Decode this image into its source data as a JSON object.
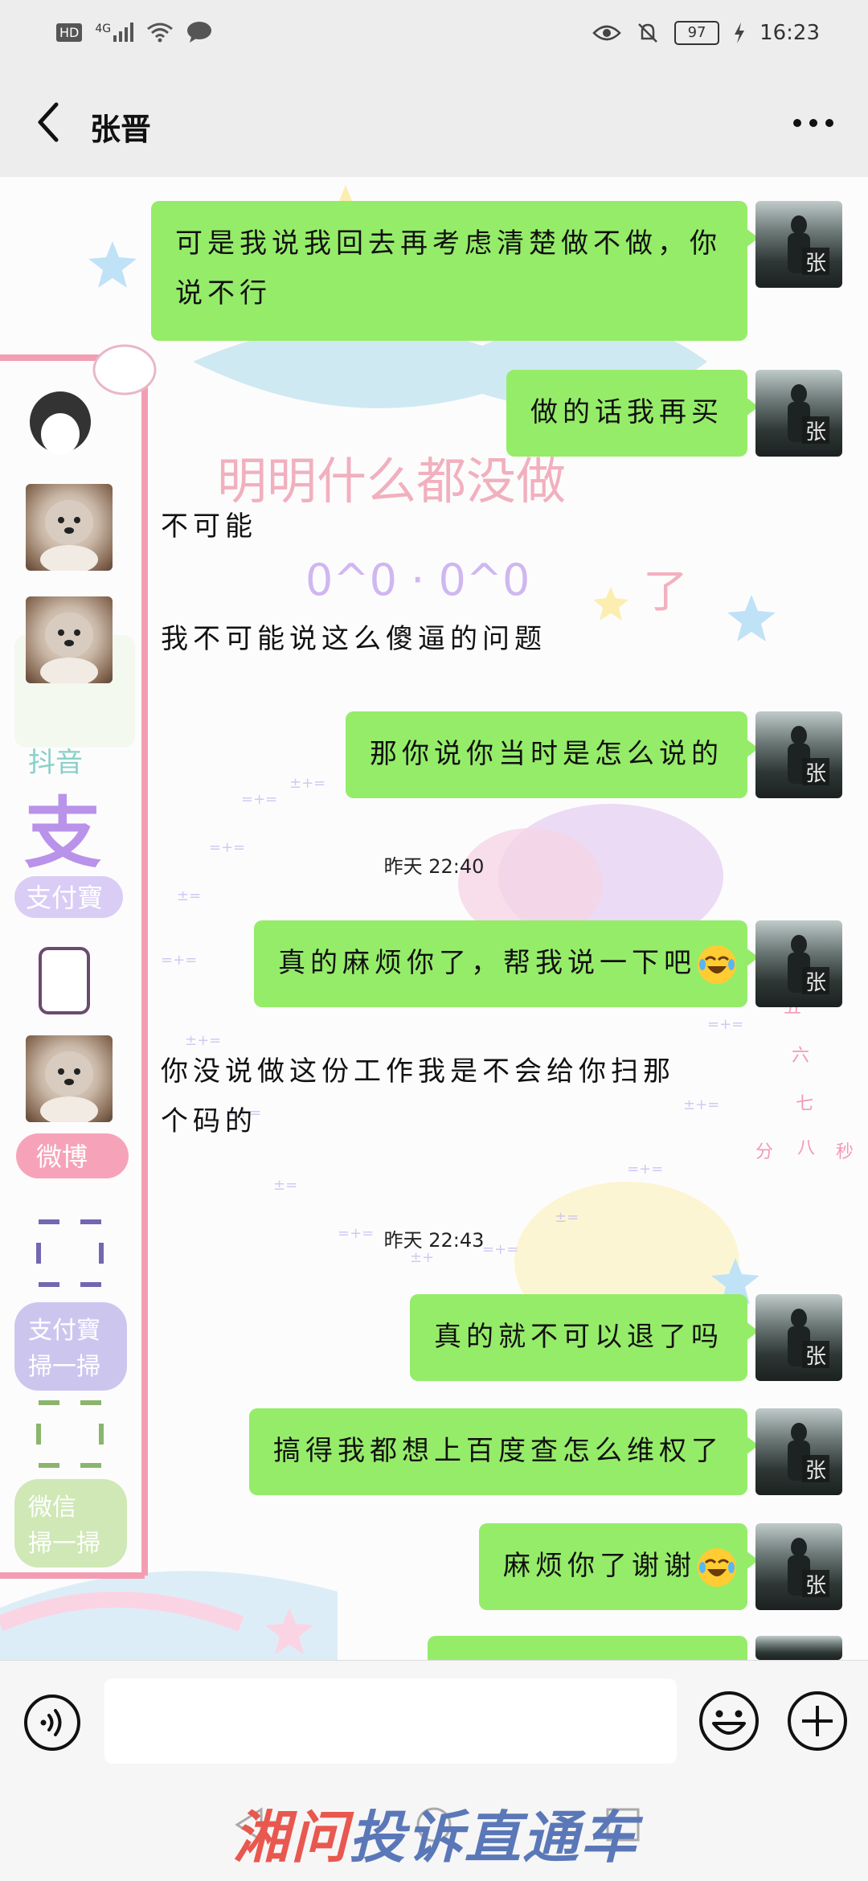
{
  "status_bar": {
    "left_icons": [
      "hd-icon",
      "4g-signal-icon",
      "wifi-icon",
      "message-icon"
    ],
    "hd_label": "HD",
    "network_label": "4G",
    "right_icons": [
      "eye-icon",
      "mute-bell-icon",
      "battery-icon",
      "charging-icon"
    ],
    "battery": "97",
    "time": "16:23"
  },
  "header": {
    "title": "张晋"
  },
  "wallpaper_text": {
    "headline": "明明什么都没做",
    "app_labels": [
      "抖音",
      "支付寶",
      "微博",
      "支付寶\n掃一掃",
      "微信\n掃一掃"
    ]
  },
  "messages": [
    {
      "side": "out",
      "text": "可是我说我回去再考虑清楚做不做，你说不行"
    },
    {
      "side": "out",
      "text": "做的话我再买"
    },
    {
      "side": "in",
      "text": "不可能"
    },
    {
      "side": "in",
      "text": "我不可能说这么傻逼的问题"
    },
    {
      "side": "out",
      "text": "那你说你当时是怎么说的"
    },
    {
      "side": "out",
      "text": "真的麻烦你了，帮我说一下吧"
    },
    {
      "side": "in",
      "text": "你没说做这份工作我是不会给你扫那个码的"
    },
    {
      "side": "out",
      "text": "真的就不可以退了吗"
    },
    {
      "side": "out",
      "text": "搞得我都想上百度查怎么维权了"
    },
    {
      "side": "out",
      "text": "麻烦你了谢谢"
    }
  ],
  "timestamps": [
    "昨天 22:40",
    "昨天 22:43"
  ],
  "my_avatar_glyph": "张",
  "input": {
    "value": "",
    "voice_icon": "voice-icon",
    "emoji_icon": "emoji-icon",
    "plus_icon": "plus-icon"
  },
  "watermark": {
    "part1": "湘问",
    "part2": "投诉直通车"
  },
  "colors": {
    "outgoing_bubble": "#95ec69",
    "header_bg": "#ededed"
  }
}
